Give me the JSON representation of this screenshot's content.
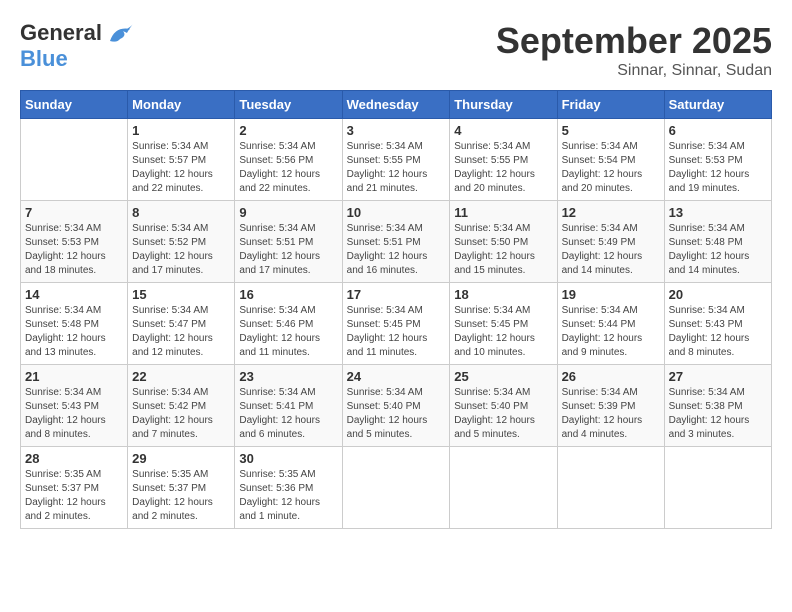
{
  "logo": {
    "general": "General",
    "blue": "Blue"
  },
  "title": "September 2025",
  "subtitle": "Sinnar, Sinnar, Sudan",
  "days_header": [
    "Sunday",
    "Monday",
    "Tuesday",
    "Wednesday",
    "Thursday",
    "Friday",
    "Saturday"
  ],
  "weeks": [
    [
      {
        "day": "",
        "info": ""
      },
      {
        "day": "1",
        "info": "Sunrise: 5:34 AM\nSunset: 5:57 PM\nDaylight: 12 hours\nand 22 minutes."
      },
      {
        "day": "2",
        "info": "Sunrise: 5:34 AM\nSunset: 5:56 PM\nDaylight: 12 hours\nand 22 minutes."
      },
      {
        "day": "3",
        "info": "Sunrise: 5:34 AM\nSunset: 5:55 PM\nDaylight: 12 hours\nand 21 minutes."
      },
      {
        "day": "4",
        "info": "Sunrise: 5:34 AM\nSunset: 5:55 PM\nDaylight: 12 hours\nand 20 minutes."
      },
      {
        "day": "5",
        "info": "Sunrise: 5:34 AM\nSunset: 5:54 PM\nDaylight: 12 hours\nand 20 minutes."
      },
      {
        "day": "6",
        "info": "Sunrise: 5:34 AM\nSunset: 5:53 PM\nDaylight: 12 hours\nand 19 minutes."
      }
    ],
    [
      {
        "day": "7",
        "info": "Sunrise: 5:34 AM\nSunset: 5:53 PM\nDaylight: 12 hours\nand 18 minutes."
      },
      {
        "day": "8",
        "info": "Sunrise: 5:34 AM\nSunset: 5:52 PM\nDaylight: 12 hours\nand 17 minutes."
      },
      {
        "day": "9",
        "info": "Sunrise: 5:34 AM\nSunset: 5:51 PM\nDaylight: 12 hours\nand 17 minutes."
      },
      {
        "day": "10",
        "info": "Sunrise: 5:34 AM\nSunset: 5:51 PM\nDaylight: 12 hours\nand 16 minutes."
      },
      {
        "day": "11",
        "info": "Sunrise: 5:34 AM\nSunset: 5:50 PM\nDaylight: 12 hours\nand 15 minutes."
      },
      {
        "day": "12",
        "info": "Sunrise: 5:34 AM\nSunset: 5:49 PM\nDaylight: 12 hours\nand 14 minutes."
      },
      {
        "day": "13",
        "info": "Sunrise: 5:34 AM\nSunset: 5:48 PM\nDaylight: 12 hours\nand 14 minutes."
      }
    ],
    [
      {
        "day": "14",
        "info": "Sunrise: 5:34 AM\nSunset: 5:48 PM\nDaylight: 12 hours\nand 13 minutes."
      },
      {
        "day": "15",
        "info": "Sunrise: 5:34 AM\nSunset: 5:47 PM\nDaylight: 12 hours\nand 12 minutes."
      },
      {
        "day": "16",
        "info": "Sunrise: 5:34 AM\nSunset: 5:46 PM\nDaylight: 12 hours\nand 11 minutes."
      },
      {
        "day": "17",
        "info": "Sunrise: 5:34 AM\nSunset: 5:45 PM\nDaylight: 12 hours\nand 11 minutes."
      },
      {
        "day": "18",
        "info": "Sunrise: 5:34 AM\nSunset: 5:45 PM\nDaylight: 12 hours\nand 10 minutes."
      },
      {
        "day": "19",
        "info": "Sunrise: 5:34 AM\nSunset: 5:44 PM\nDaylight: 12 hours\nand 9 minutes."
      },
      {
        "day": "20",
        "info": "Sunrise: 5:34 AM\nSunset: 5:43 PM\nDaylight: 12 hours\nand 8 minutes."
      }
    ],
    [
      {
        "day": "21",
        "info": "Sunrise: 5:34 AM\nSunset: 5:43 PM\nDaylight: 12 hours\nand 8 minutes."
      },
      {
        "day": "22",
        "info": "Sunrise: 5:34 AM\nSunset: 5:42 PM\nDaylight: 12 hours\nand 7 minutes."
      },
      {
        "day": "23",
        "info": "Sunrise: 5:34 AM\nSunset: 5:41 PM\nDaylight: 12 hours\nand 6 minutes."
      },
      {
        "day": "24",
        "info": "Sunrise: 5:34 AM\nSunset: 5:40 PM\nDaylight: 12 hours\nand 5 minutes."
      },
      {
        "day": "25",
        "info": "Sunrise: 5:34 AM\nSunset: 5:40 PM\nDaylight: 12 hours\nand 5 minutes."
      },
      {
        "day": "26",
        "info": "Sunrise: 5:34 AM\nSunset: 5:39 PM\nDaylight: 12 hours\nand 4 minutes."
      },
      {
        "day": "27",
        "info": "Sunrise: 5:34 AM\nSunset: 5:38 PM\nDaylight: 12 hours\nand 3 minutes."
      }
    ],
    [
      {
        "day": "28",
        "info": "Sunrise: 5:35 AM\nSunset: 5:37 PM\nDaylight: 12 hours\nand 2 minutes."
      },
      {
        "day": "29",
        "info": "Sunrise: 5:35 AM\nSunset: 5:37 PM\nDaylight: 12 hours\nand 2 minutes."
      },
      {
        "day": "30",
        "info": "Sunrise: 5:35 AM\nSunset: 5:36 PM\nDaylight: 12 hours\nand 1 minute."
      },
      {
        "day": "",
        "info": ""
      },
      {
        "day": "",
        "info": ""
      },
      {
        "day": "",
        "info": ""
      },
      {
        "day": "",
        "info": ""
      }
    ]
  ]
}
